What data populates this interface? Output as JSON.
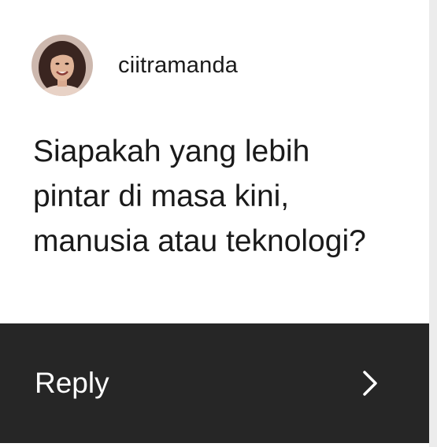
{
  "post": {
    "username": "ciitramanda",
    "avatar_icon": "profile-photo",
    "question": "Siapakah yang lebih pintar di masa kini, manusia atau teknologi?"
  },
  "reply": {
    "label": "Reply",
    "icon": "chevron-right-icon"
  },
  "colors": {
    "card_background": "#ffffff",
    "reply_bar": "#262626",
    "text_dark": "#1a1a1a",
    "text_light": "#ffffff"
  }
}
